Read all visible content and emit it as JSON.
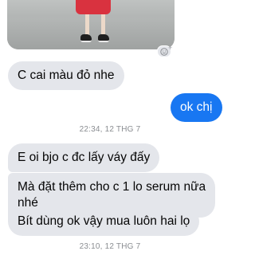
{
  "messages": [
    {
      "sender": "them",
      "text": "C cai màu đỏ nhe"
    },
    {
      "sender": "me",
      "text": "ok chị"
    },
    {
      "sender": "them",
      "text": "E oi bjo c đc lấy váy đấy"
    },
    {
      "sender": "them",
      "text_line1": "Mà đặt thêm cho c 1 lo serum nữa",
      "text_line2": "nhé"
    },
    {
      "sender": "them",
      "text": "Bít dùng ok vậy mua luôn hai lọ"
    }
  ],
  "timestamps": [
    "22:34, 12 THG 7",
    "23:10, 12 THG 7"
  ],
  "reaction": {
    "icon": "smiley-icon",
    "plus": "+"
  },
  "colors": {
    "incoming_bubble": "#e4e6eb",
    "outgoing_bubble": "#1877f2",
    "timestamp_text": "#8a8d91",
    "background": "#ffffff"
  }
}
